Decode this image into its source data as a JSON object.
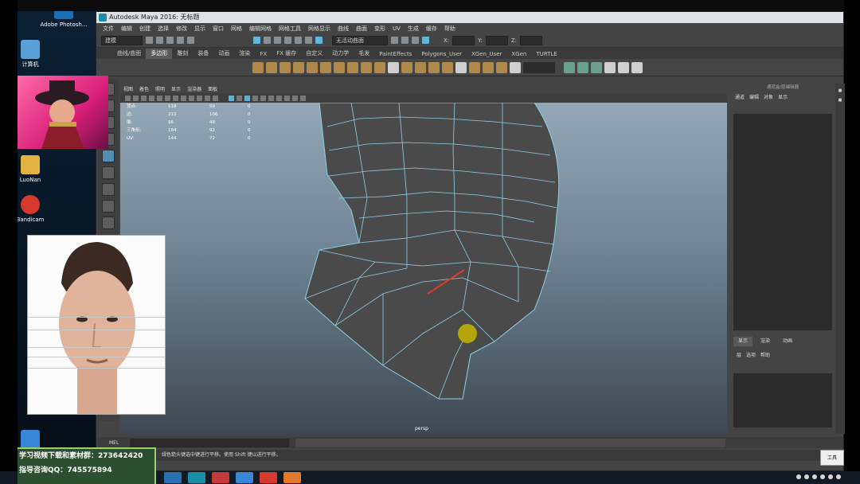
{
  "desktop": {
    "icons": [
      {
        "label": "Adobe Photosh...",
        "name": "adobe-photoshop"
      },
      {
        "label": "计算机",
        "name": "computer"
      },
      {
        "label": "LuoNan",
        "name": "luonan-folder"
      },
      {
        "label": "Bandicam",
        "name": "bandicam"
      }
    ]
  },
  "window": {
    "title": "Autodesk Maya 2016: 无标题",
    "menubar": [
      "文件",
      "编辑",
      "创建",
      "选择",
      "修改",
      "显示",
      "窗口",
      "网格",
      "编辑网格",
      "网格工具",
      "网格显示",
      "曲线",
      "曲面",
      "变形",
      "UV",
      "生成",
      "缓存",
      "帮助"
    ],
    "mode_dropdown": "建模",
    "status_field_label": "无活动曲面",
    "xyz_labels": [
      "X:",
      "Y:",
      "Z:"
    ]
  },
  "shelf": {
    "tabs": [
      "曲线/曲面",
      "多边形",
      "雕刻",
      "装备",
      "动画",
      "渲染",
      "FX",
      "FX 缓存",
      "自定义",
      "动力学",
      "毛发",
      "PaintEffects",
      "Polygons_User",
      "XGen_User",
      "XGen",
      "TURTLE"
    ],
    "active_tab": "多边形"
  },
  "viewport": {
    "panel_menu": [
      "视图",
      "着色",
      "照明",
      "显示",
      "渲染器",
      "面板"
    ],
    "hud": [
      {
        "label": "顶点:",
        "v1": "118",
        "v2": "59",
        "v3": "0"
      },
      {
        "label": "边:",
        "v1": "212",
        "v2": "106",
        "v3": "0"
      },
      {
        "label": "面:",
        "v1": "96",
        "v2": "48",
        "v3": "0"
      },
      {
        "label": "三角形:",
        "v1": "184",
        "v2": "92",
        "v3": "0"
      },
      {
        "label": "UV:",
        "v1": "144",
        "v2": "72",
        "v3": "0"
      }
    ],
    "camera_label": "persp"
  },
  "right_panel": {
    "title": "通道盒/层编辑器",
    "tabs": [
      "通道",
      "编辑",
      "对象",
      "显示"
    ],
    "layer_tabs": [
      "显示",
      "渲染",
      "动画"
    ],
    "layer_sub": [
      "层",
      "选项",
      "帮助"
    ]
  },
  "bottom": {
    "mel_label": "MEL",
    "help_text": "绿色箭头键选中键进行平移。使用 Shift 键以进行平移。",
    "tool_button": "工具"
  },
  "promo": {
    "line1_label": "学习视频下载和素材群：",
    "line1_value": "273642420",
    "line2_label": "指导咨询QQ：",
    "line2_value": "745575894"
  },
  "colors": {
    "maya_bg": "#444444",
    "viewport_top": "#93a8b6",
    "viewport_bottom": "#3e4852",
    "wireframe": "#8fd0e6",
    "selected_edge": "#e03a2a",
    "promo_border": "#9bcf6e"
  }
}
